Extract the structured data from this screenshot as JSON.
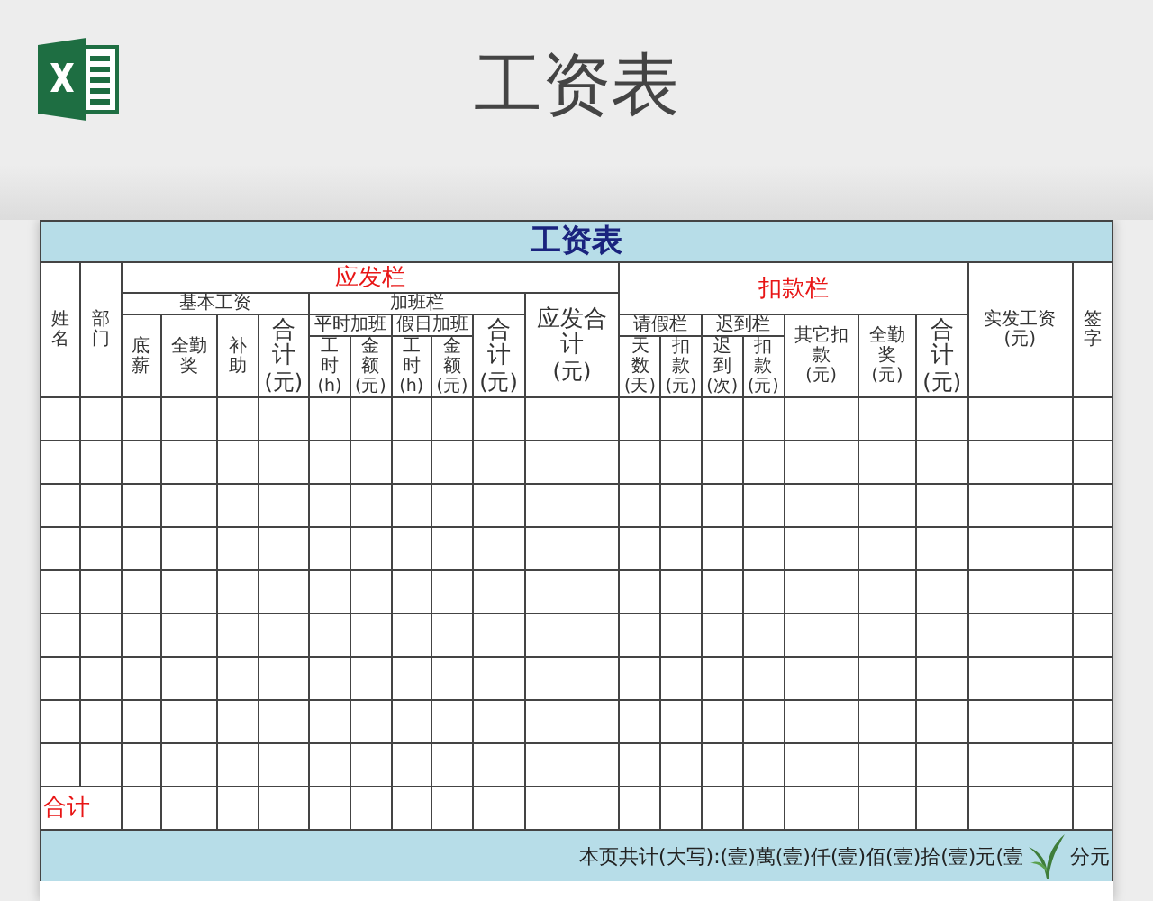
{
  "page_title": "工资表",
  "sheet": {
    "title": "工资表",
    "header_rows": [
      [
        {
          "text": "姓名",
          "rowspan": 4,
          "kind": "label"
        },
        {
          "text": "部门",
          "rowspan": 4,
          "kind": "label"
        },
        {
          "text": "应发栏",
          "colspan": 10,
          "kind": "section"
        },
        {
          "text": "扣款栏",
          "colspan": 7,
          "rowspan": 2,
          "kind": "section"
        },
        {
          "text": "实发工资(元)",
          "rowspan": 4,
          "kind": "label"
        },
        {
          "text": "签字",
          "rowspan": 4,
          "kind": "label"
        }
      ],
      [
        {
          "text": "基本工资",
          "colspan": 4,
          "kind": "label"
        },
        {
          "text": "加班栏",
          "colspan": 5,
          "kind": "label"
        },
        {
          "text": "应发合计",
          "unit": "(元)",
          "rowspan": 3,
          "kind": "total"
        }
      ],
      [
        {
          "text": "底薪",
          "rowspan": 2,
          "kind": "label"
        },
        {
          "text": "全勤奖",
          "rowspan": 2,
          "kind": "label"
        },
        {
          "text": "补助",
          "rowspan": 2,
          "kind": "label"
        },
        {
          "text": "合计",
          "unit": "(元)",
          "rowspan": 2,
          "kind": "total"
        },
        {
          "text": "平时加班",
          "colspan": 2,
          "kind": "label"
        },
        {
          "text": "假日加班",
          "colspan": 2,
          "kind": "label"
        },
        {
          "text": "合计",
          "unit": "(元)",
          "rowspan": 2,
          "kind": "total"
        },
        {
          "text": "请假栏",
          "colspan": 2,
          "kind": "label"
        },
        {
          "text": "迟到栏",
          "colspan": 2,
          "kind": "label"
        },
        {
          "text": "其它扣款",
          "unit": "(元)",
          "rowspan": 2,
          "kind": "label"
        },
        {
          "text": "全勤奖",
          "unit": "(元)",
          "rowspan": 2,
          "kind": "label"
        },
        {
          "text": "合计",
          "unit": "(元)",
          "rowspan": 2,
          "kind": "total"
        }
      ],
      [
        {
          "text": "工时",
          "unit": "(h)",
          "kind": "label"
        },
        {
          "text": "金额",
          "unit": "(元)",
          "kind": "label"
        },
        {
          "text": "工时",
          "unit": "(h)",
          "kind": "label"
        },
        {
          "text": "金额",
          "unit": "(元)",
          "kind": "label"
        },
        {
          "text": "天数",
          "unit": "(天)",
          "kind": "label"
        },
        {
          "text": "扣款",
          "unit": "(元)",
          "kind": "label"
        },
        {
          "text": "迟到",
          "unit": "(次)",
          "kind": "label"
        },
        {
          "text": "扣款",
          "unit": "(元)",
          "kind": "label"
        }
      ]
    ],
    "total_label": "合计",
    "footer_text": "本页共计(大写):(壹)萬(壹)仟(壹)佰(壹)拾(壹)元(壹",
    "footer_tail": "分元"
  }
}
